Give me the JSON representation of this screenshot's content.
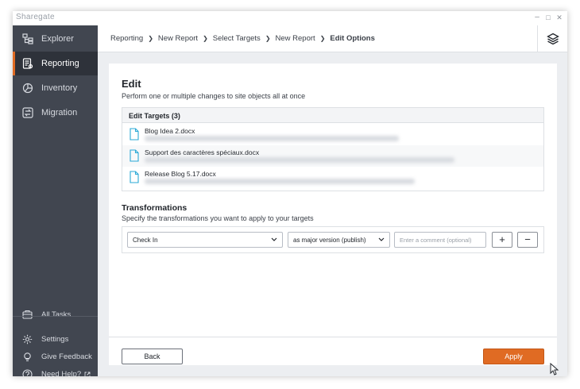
{
  "app": {
    "brand": "Sharegate",
    "minimize": "–",
    "maximize": "□",
    "close": "✕"
  },
  "sidebar": {
    "items": [
      {
        "label": "Explorer",
        "icon": "explorer-icon"
      },
      {
        "label": "Reporting",
        "icon": "reporting-icon",
        "active": true
      },
      {
        "label": "Inventory",
        "icon": "inventory-icon"
      },
      {
        "label": "Migration",
        "icon": "migration-icon"
      }
    ],
    "all_tasks": "All Tasks",
    "settings": "Settings",
    "feedback": "Give Feedback",
    "help": "Need Help?"
  },
  "breadcrumb": [
    "Reporting",
    "New Report",
    "Select Targets",
    "New Report",
    "Edit Options"
  ],
  "edit": {
    "title": "Edit",
    "subtitle": "Perform one or multiple changes to site objects all at once"
  },
  "targets": {
    "header": "Edit Targets (3)",
    "items": [
      {
        "name": "Blog Idea 2.docx"
      },
      {
        "name": "Support des caractères spéciaux.docx"
      },
      {
        "name": "Release Blog 5.17.docx"
      }
    ]
  },
  "transformations": {
    "title": "Transformations",
    "subtitle": "Specify the transformations you want to apply to your targets",
    "action": "Check In",
    "version": "as major version (publish)",
    "comment_placeholder": "Enter a comment (optional)",
    "add": "+",
    "remove": "−"
  },
  "footer": {
    "back": "Back",
    "apply": "Apply"
  },
  "colors": {
    "accent": "#e06b23",
    "sidebar": "#414650",
    "sidebar_active": "#2e323a",
    "file_icon": "#2aa9d6"
  }
}
